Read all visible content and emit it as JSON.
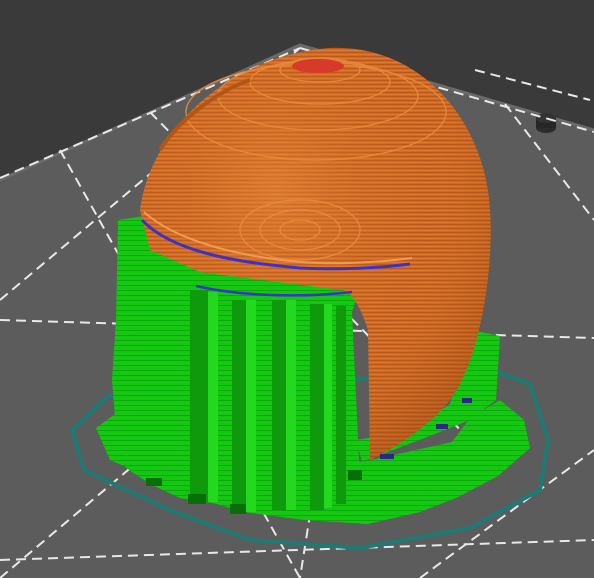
{
  "viewport": {
    "kind": "3D slicer preview",
    "background_color": "#3a3a3a",
    "bed_color": "#5e5e5e",
    "bed_edge_color": "#4a4a4a",
    "grid_line_color": "#e8e8e8",
    "grid_style": "dashed"
  },
  "model": {
    "shell_color": "#d2691e",
    "shell_dark_color": "#a34d12",
    "shell_light_color": "#e98a3a",
    "top_layer_color": "#d63a2a",
    "support_color": "#12c40f",
    "support_dark_color": "#0a8e08",
    "brim_outline_color": "#1e7a74",
    "inner_perimeter_color": "#3b32c8"
  }
}
